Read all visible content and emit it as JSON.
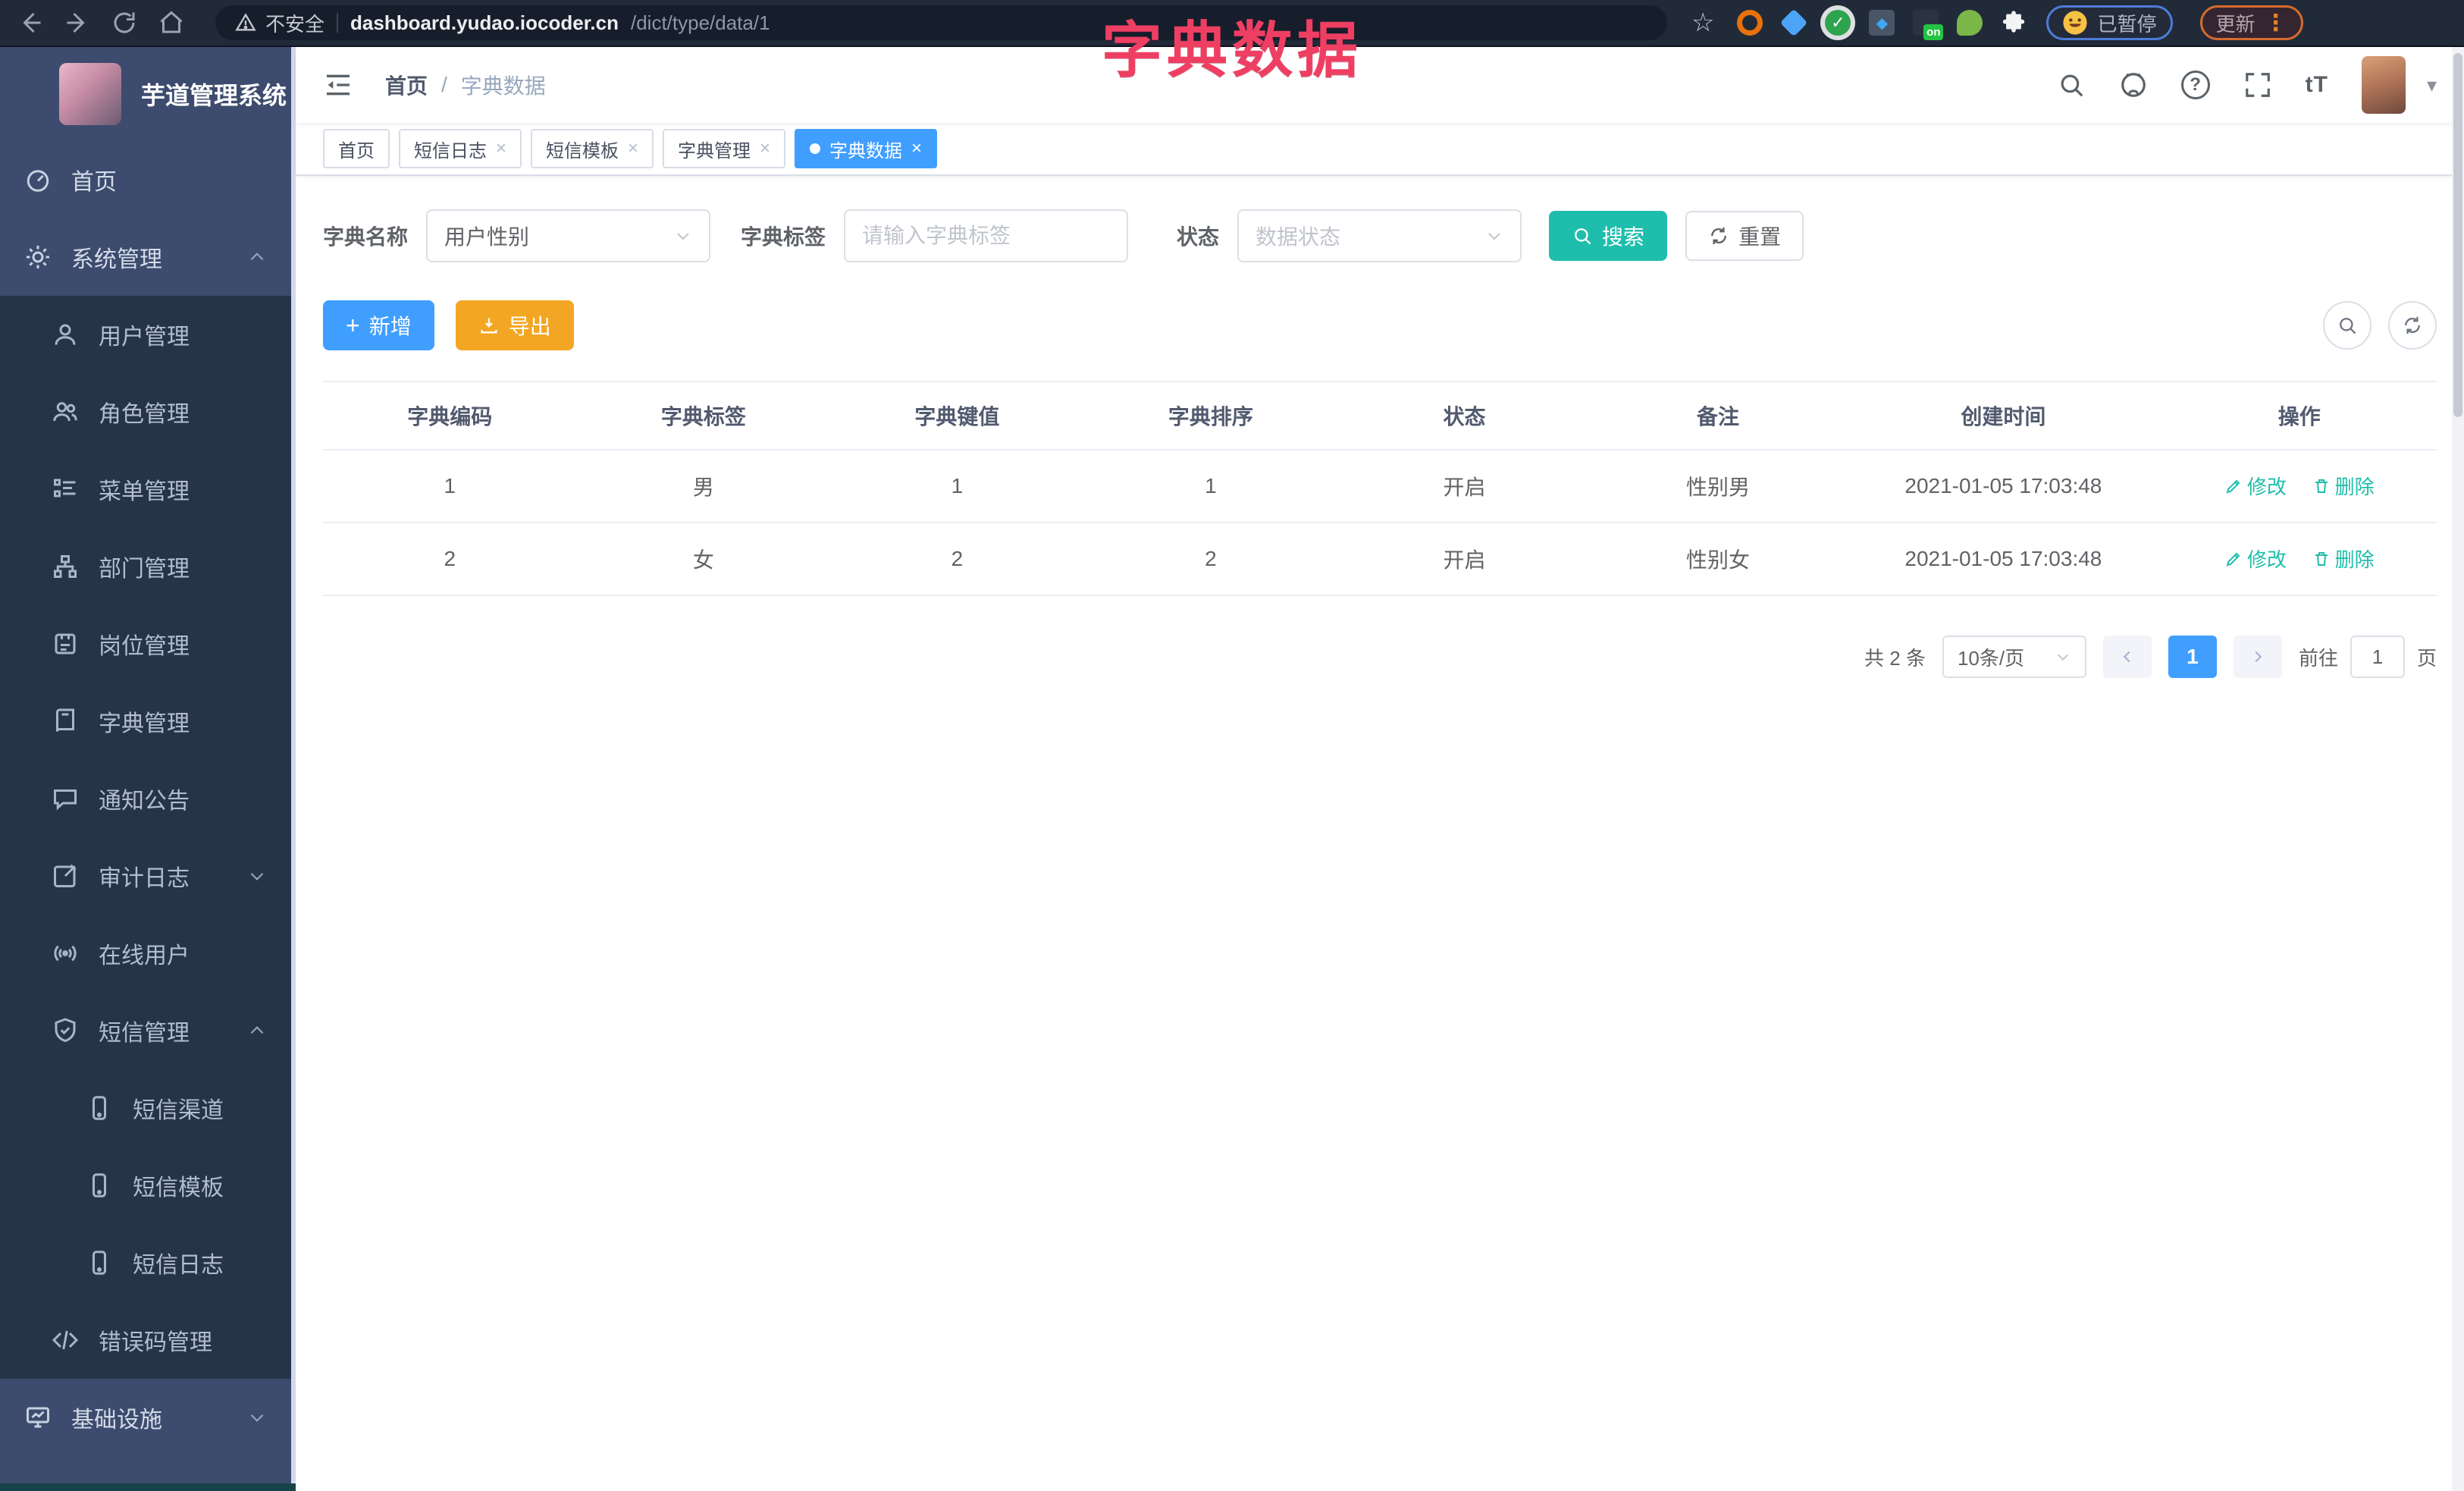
{
  "browser": {
    "security_label": "不安全",
    "url_host": "dashboard.yudao.iocoder.cn",
    "url_path": "/dict/type/data/1",
    "paused_chip_label": "已暂停",
    "update_chip_label": "更新",
    "extension_on_badge": "on"
  },
  "icons": {
    "close": "×",
    "plus": "+",
    "caret_down": "▾",
    "star": "☆",
    "more_vertical": "⋮",
    "question": "?",
    "check": "✓",
    "diamond": "◆",
    "font_size": "tT"
  },
  "overlay_title": "字典数据",
  "sidebar": {
    "logo_title": "芋道管理系统",
    "items": [
      {
        "label": "首页",
        "icon": "dashboard-icon",
        "level": 1
      },
      {
        "label": "系统管理",
        "icon": "gear-icon",
        "level": 1,
        "state": "expanded"
      },
      {
        "label": "用户管理",
        "icon": "user-icon",
        "level": 2
      },
      {
        "label": "角色管理",
        "icon": "users-icon",
        "level": 2
      },
      {
        "label": "菜单管理",
        "icon": "menu-list-icon",
        "level": 2
      },
      {
        "label": "部门管理",
        "icon": "org-tree-icon",
        "level": 2
      },
      {
        "label": "岗位管理",
        "icon": "id-card-icon",
        "level": 2
      },
      {
        "label": "字典管理",
        "icon": "dictionary-icon",
        "level": 2
      },
      {
        "label": "通知公告",
        "icon": "announcement-icon",
        "level": 2
      },
      {
        "label": "审计日志",
        "icon": "audit-log-icon",
        "level": 2,
        "state": "collapsed"
      },
      {
        "label": "在线用户",
        "icon": "online-user-icon",
        "level": 2
      },
      {
        "label": "短信管理",
        "icon": "shield-check-icon",
        "level": 2,
        "state": "expanded"
      },
      {
        "label": "短信渠道",
        "icon": "phone-icon",
        "level": 3
      },
      {
        "label": "短信模板",
        "icon": "phone-icon",
        "level": 3
      },
      {
        "label": "短信日志",
        "icon": "phone-icon",
        "level": 3
      },
      {
        "label": "错误码管理",
        "icon": "code-icon",
        "level": 2
      },
      {
        "label": "基础设施",
        "icon": "monitor-icon",
        "level": 1,
        "state": "collapsed"
      }
    ]
  },
  "header": {
    "breadcrumb": {
      "home": "首页",
      "separator": "/",
      "current": "字典数据"
    }
  },
  "tabs": [
    {
      "label": "首页"
    },
    {
      "label": "短信日志"
    },
    {
      "label": "短信模板"
    },
    {
      "label": "字典管理"
    },
    {
      "label": "字典数据",
      "active": true
    }
  ],
  "filter": {
    "dict_name_label": "字典名称",
    "dict_name_value": "用户性别",
    "dict_label_label": "字典标签",
    "dict_label_placeholder": "请输入字典标签",
    "status_label": "状态",
    "status_placeholder": "数据状态",
    "search_label": "搜索",
    "reset_label": "重置"
  },
  "actions": {
    "add_label": "新增",
    "export_label": "导出"
  },
  "table": {
    "headers": [
      "字典编码",
      "字典标签",
      "字典键值",
      "字典排序",
      "状态",
      "备注",
      "创建时间",
      "操作"
    ],
    "rows": [
      {
        "code": "1",
        "label": "男",
        "value": "1",
        "sort": "1",
        "status": "开启",
        "remark": "性别男",
        "created": "2021-01-05 17:03:48",
        "edit": "修改",
        "delete": "删除"
      },
      {
        "code": "2",
        "label": "女",
        "value": "2",
        "sort": "2",
        "status": "开启",
        "remark": "性别女",
        "created": "2021-01-05 17:03:48",
        "edit": "修改",
        "delete": "删除"
      }
    ]
  },
  "pagination": {
    "total": "共 2 条",
    "page_size": "10条/页",
    "current_page": "1",
    "goto_label": "前往",
    "goto_value": "1",
    "goto_unit": "页"
  },
  "colors": {
    "primary": "#409eff",
    "teal": "#1fbdab",
    "warning": "#f3a623",
    "overlay_pink": "#ee3f63",
    "sidebar_bg": "#3d4b6e",
    "submenu_bg": "#263449",
    "toolbar_bg": "#212a38"
  }
}
